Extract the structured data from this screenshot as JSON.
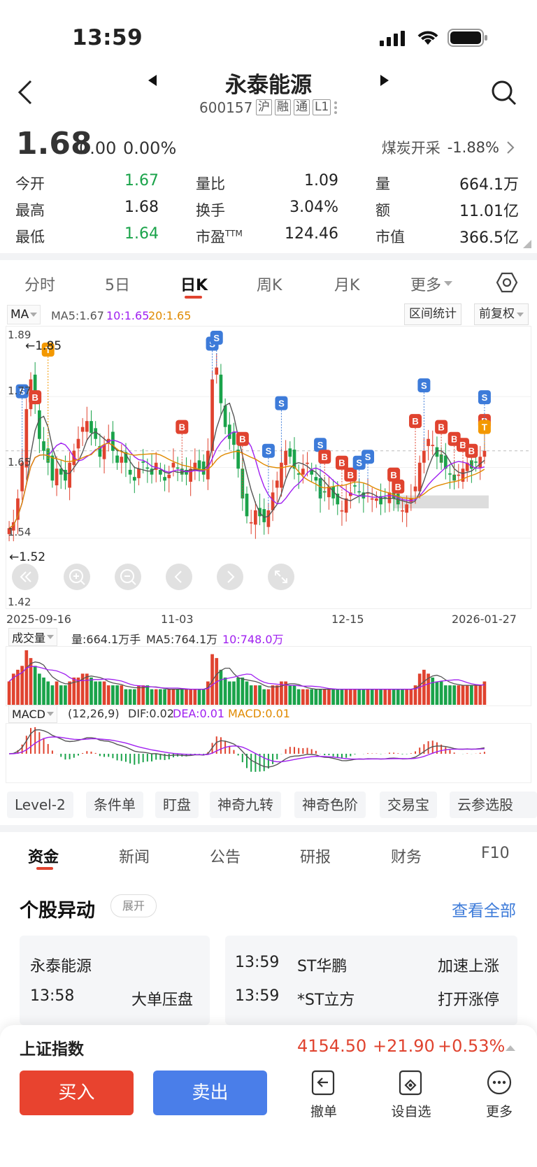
{
  "status_bar": {
    "time": "13:59"
  },
  "header": {
    "title": "永泰能源",
    "code": "600157",
    "tags": [
      "沪",
      "融",
      "通",
      "L1"
    ]
  },
  "quote": {
    "price": "1.68",
    "change": "0.00",
    "change_pct": "0.00%",
    "sector_name": "煤炭开采",
    "sector_pct": "-1.88%",
    "stats": [
      {
        "label": "今开",
        "value": "1.67",
        "color": "down"
      },
      {
        "label": "量比",
        "value": "1.09",
        "color": "flat"
      },
      {
        "label": "量",
        "value": "664.1万",
        "color": "flat"
      },
      {
        "label": "最高",
        "value": "1.68",
        "color": "flat"
      },
      {
        "label": "换手",
        "value": "3.04%",
        "color": "flat"
      },
      {
        "label": "额",
        "value": "11.01亿",
        "color": "flat"
      },
      {
        "label": "最低",
        "value": "1.64",
        "color": "down"
      },
      {
        "label": "市盈TTM",
        "value": "124.46",
        "color": "flat"
      },
      {
        "label": "市值",
        "value": "366.5亿",
        "color": "flat"
      }
    ]
  },
  "period_tabs": [
    "分时",
    "5日",
    "日K",
    "周K",
    "月K",
    "更多"
  ],
  "active_period": "日K",
  "chart": {
    "ma_selector": "MA",
    "ma5": "MA5:1.67",
    "ma10": "10:1.65",
    "ma20": "20:1.65",
    "range_stats": "区间统计",
    "adjust": "前复权",
    "max_label": "←1.85",
    "min_label": "←1.52",
    "y_ticks": [
      "1.89",
      "1.77",
      "1.65",
      "1.54",
      "1.42"
    ],
    "dates": [
      "2025-09-16",
      "11-03",
      "12-15",
      "2026-01-27"
    ],
    "volume_selector": "成交量",
    "volume_text": "量:664.1万手",
    "vol_ma5": "MA5:764.1万",
    "vol_ma10": "10:748.0万",
    "macd_selector": "MACD",
    "macd_params": "(12,26,9)",
    "dif": "DIF:0.02",
    "dea": "DEA:0.01",
    "macd": "MACD:0.01",
    "colors": {
      "up": "#e0432f",
      "down": "#1aa34a",
      "ma5": "#555555",
      "ma10": "#a020f0",
      "ma20": "#e08a00",
      "buy_marker": "#e0432f",
      "sell_marker": "#3d7bd9",
      "t_marker": "#f39800"
    }
  },
  "chart_data": {
    "type": "candlestick",
    "title": "",
    "ylim": [
      1.42,
      1.89
    ],
    "x_labels": [
      "2025-09-16",
      "11-03",
      "12-15",
      "2026-01-27"
    ],
    "closes": [
      1.55,
      1.56,
      1.6,
      1.66,
      1.75,
      1.8,
      1.76,
      1.7,
      1.68,
      1.66,
      1.63,
      1.65,
      1.64,
      1.63,
      1.66,
      1.68,
      1.7,
      1.72,
      1.73,
      1.71,
      1.7,
      1.67,
      1.69,
      1.7,
      1.68,
      1.66,
      1.67,
      1.66,
      1.64,
      1.63,
      1.65,
      1.66,
      1.65,
      1.64,
      1.66,
      1.64,
      1.63,
      1.64,
      1.66,
      1.65,
      1.64,
      1.64,
      1.65,
      1.66,
      1.65,
      1.64,
      1.68,
      1.8,
      1.82,
      1.76,
      1.72,
      1.7,
      1.69,
      1.65,
      1.6,
      1.57,
      1.56,
      1.58,
      1.57,
      1.56,
      1.58,
      1.61,
      1.63,
      1.66,
      1.68,
      1.67,
      1.65,
      1.64,
      1.65,
      1.66,
      1.64,
      1.63,
      1.6,
      1.61,
      1.62,
      1.6,
      1.59,
      1.58,
      1.6,
      1.61,
      1.62,
      1.61,
      1.6,
      1.61,
      1.6,
      1.6,
      1.59,
      1.6,
      1.61,
      1.6,
      1.59,
      1.58,
      1.59,
      1.6,
      1.62,
      1.66,
      1.68,
      1.7,
      1.69,
      1.67,
      1.66,
      1.65,
      1.64,
      1.63,
      1.64,
      1.65,
      1.66,
      1.65,
      1.66,
      1.67,
      1.68
    ],
    "volume": [
      6,
      8,
      9,
      10,
      14,
      12,
      10,
      8,
      7,
      6,
      5,
      6,
      5,
      5,
      6,
      7,
      7,
      8,
      8,
      7,
      6,
      6,
      6,
      5,
      5,
      5,
      5,
      4,
      4,
      4,
      5,
      5,
      5,
      4,
      4,
      4,
      4,
      4,
      4,
      4,
      4,
      4,
      4,
      4,
      4,
      4,
      6,
      13,
      12,
      9,
      7,
      6,
      6,
      7,
      7,
      6,
      5,
      5,
      5,
      4,
      4,
      5,
      5,
      6,
      6,
      5,
      5,
      4,
      4,
      4,
      4,
      4,
      4,
      4,
      4,
      4,
      4,
      4,
      4,
      4,
      4,
      4,
      4,
      4,
      4,
      4,
      4,
      4,
      4,
      4,
      4,
      4,
      4,
      4,
      5,
      8,
      9,
      8,
      7,
      6,
      6,
      5,
      5,
      5,
      5,
      5,
      5,
      5,
      5,
      5,
      6
    ],
    "volume_unit": "万手",
    "markers": [
      {
        "type": "S",
        "index": 3,
        "price": 1.78
      },
      {
        "type": "B",
        "index": 6,
        "price": 1.77
      },
      {
        "type": "T",
        "index": 9,
        "price": 1.85
      },
      {
        "type": "B",
        "index": 40,
        "price": 1.72
      },
      {
        "type": "S",
        "index": 47,
        "price": 1.86
      },
      {
        "type": "S",
        "index": 48,
        "price": 1.87
      },
      {
        "type": "B",
        "index": 54,
        "price": 1.7
      },
      {
        "type": "S",
        "index": 63,
        "price": 1.76
      },
      {
        "type": "S",
        "index": 60,
        "price": 1.68
      },
      {
        "type": "S",
        "index": 72,
        "price": 1.69
      },
      {
        "type": "B",
        "index": 73,
        "price": 1.67
      },
      {
        "type": "B",
        "index": 77,
        "price": 1.66
      },
      {
        "type": "B",
        "index": 79,
        "price": 1.64
      },
      {
        "type": "S",
        "index": 81,
        "price": 1.66
      },
      {
        "type": "S",
        "index": 83,
        "price": 1.67
      },
      {
        "type": "B",
        "index": 89,
        "price": 1.64
      },
      {
        "type": "B",
        "index": 90,
        "price": 1.62
      },
      {
        "type": "B",
        "index": 94,
        "price": 1.73
      },
      {
        "type": "S",
        "index": 96,
        "price": 1.79
      },
      {
        "type": "B",
        "index": 100,
        "price": 1.72
      },
      {
        "type": "B",
        "index": 103,
        "price": 1.7
      },
      {
        "type": "B",
        "index": 105,
        "price": 1.69
      },
      {
        "type": "B",
        "index": 107,
        "price": 1.68
      },
      {
        "type": "B",
        "index": 111,
        "price": 1.73
      },
      {
        "type": "S",
        "index": 112,
        "price": 1.77
      },
      {
        "type": "T",
        "index": 113,
        "price": 1.72
      }
    ]
  },
  "tool_chips": [
    "Level-2",
    "条件单",
    "盯盘",
    "神奇九转",
    "神奇色阶",
    "交易宝",
    "云参选股"
  ],
  "info_tabs": [
    "资金",
    "新闻",
    "公告",
    "研报",
    "财务",
    "F10"
  ],
  "active_info_tab": "资金",
  "movement": {
    "title": "个股异动",
    "expand": "展开",
    "see_all": "查看全部",
    "left_card": {
      "name": "永泰能源",
      "time": "13:58",
      "event": "大单压盘"
    },
    "right_card": [
      {
        "time": "13:59",
        "name": "ST华鹏",
        "event": "加速上涨"
      },
      {
        "time": "13:59",
        "name": "*ST立方",
        "event": "打开涨停"
      }
    ]
  },
  "index": {
    "name": "上证指数",
    "value": "4154.50",
    "change": "+21.90",
    "pct": "+0.53%"
  },
  "actions": {
    "buy": "买入",
    "sell": "卖出",
    "cancel": "撤单",
    "watchlist": "设自选",
    "more": "更多"
  }
}
